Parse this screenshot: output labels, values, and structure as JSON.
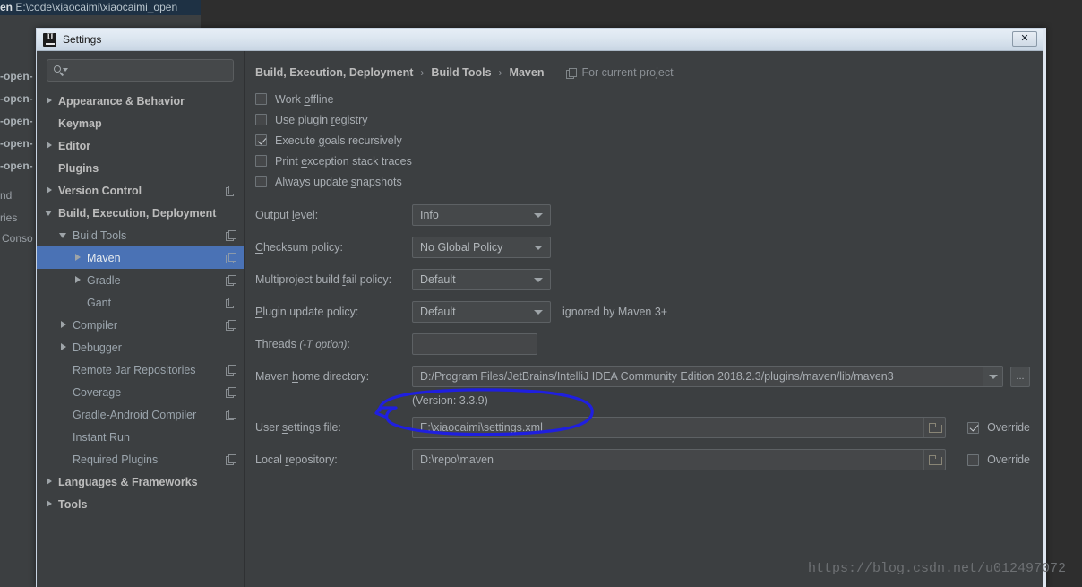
{
  "ide_background": {
    "title_text_bold": "en",
    "title_text": "E:\\code\\xiaocaimi\\xiaocaimi_open",
    "left_items": [
      "-open-",
      "-open-",
      "-open-",
      "-open-",
      "-open-",
      "nd",
      "ries",
      "Conso"
    ]
  },
  "dialog": {
    "title": "Settings",
    "icon": "intellij-idea-icon",
    "close_label": "✕"
  },
  "sidebar": {
    "search": {
      "placeholder": "",
      "value": "",
      "icon": "search-icon"
    },
    "items": [
      {
        "label": "Appearance & Behavior",
        "indent": 0,
        "arrow": "closed",
        "bold": true,
        "copy": false,
        "selected": false
      },
      {
        "label": "Keymap",
        "indent": 0,
        "arrow": "none",
        "bold": true,
        "copy": false,
        "selected": false
      },
      {
        "label": "Editor",
        "indent": 0,
        "arrow": "closed",
        "bold": true,
        "copy": false,
        "selected": false
      },
      {
        "label": "Plugins",
        "indent": 0,
        "arrow": "none",
        "bold": true,
        "copy": false,
        "selected": false
      },
      {
        "label": "Version Control",
        "indent": 0,
        "arrow": "closed",
        "bold": true,
        "copy": true,
        "selected": false
      },
      {
        "label": "Build, Execution, Deployment",
        "indent": 0,
        "arrow": "open",
        "bold": true,
        "copy": false,
        "selected": false
      },
      {
        "label": "Build Tools",
        "indent": 1,
        "arrow": "open",
        "bold": false,
        "copy": true,
        "selected": false
      },
      {
        "label": "Maven",
        "indent": 2,
        "arrow": "closed",
        "bold": false,
        "copy": true,
        "selected": true
      },
      {
        "label": "Gradle",
        "indent": 2,
        "arrow": "closed",
        "bold": false,
        "copy": true,
        "selected": false
      },
      {
        "label": "Gant",
        "indent": 2,
        "arrow": "none",
        "bold": false,
        "copy": true,
        "selected": false
      },
      {
        "label": "Compiler",
        "indent": 1,
        "arrow": "closed",
        "bold": false,
        "copy": true,
        "selected": false
      },
      {
        "label": "Debugger",
        "indent": 1,
        "arrow": "closed",
        "bold": false,
        "copy": false,
        "selected": false
      },
      {
        "label": "Remote Jar Repositories",
        "indent": 1,
        "arrow": "none",
        "bold": false,
        "copy": true,
        "selected": false
      },
      {
        "label": "Coverage",
        "indent": 1,
        "arrow": "none",
        "bold": false,
        "copy": true,
        "selected": false
      },
      {
        "label": "Gradle-Android Compiler",
        "indent": 1,
        "arrow": "none",
        "bold": false,
        "copy": true,
        "selected": false
      },
      {
        "label": "Instant Run",
        "indent": 1,
        "arrow": "none",
        "bold": false,
        "copy": false,
        "selected": false
      },
      {
        "label": "Required Plugins",
        "indent": 1,
        "arrow": "none",
        "bold": false,
        "copy": true,
        "selected": false
      },
      {
        "label": "Languages & Frameworks",
        "indent": 0,
        "arrow": "closed",
        "bold": true,
        "copy": false,
        "selected": false
      },
      {
        "label": "Tools",
        "indent": 0,
        "arrow": "closed",
        "bold": true,
        "copy": false,
        "selected": false
      }
    ]
  },
  "breadcrumb": {
    "crumbs": [
      "Build, Execution, Deployment",
      "Build Tools",
      "Maven"
    ],
    "separator": "›",
    "note": "For current project",
    "note_icon": "copy-icon"
  },
  "checkboxes": [
    {
      "pre": "Work ",
      "mn": "o",
      "post": "ffline",
      "checked": false
    },
    {
      "pre": "Use plugin ",
      "mn": "r",
      "post": "egistry",
      "checked": false
    },
    {
      "pre": "Execute ",
      "mn": "g",
      "post": "oals recursively",
      "checked": true
    },
    {
      "pre": "Print ",
      "mn": "e",
      "post": "xception stack traces",
      "checked": false
    },
    {
      "pre": "Always update ",
      "mn": "s",
      "post": "napshots",
      "checked": false
    }
  ],
  "fields": {
    "output_level": {
      "pre": "Output ",
      "mn": "l",
      "post": "evel:",
      "value": "Info"
    },
    "checksum": {
      "pre": "",
      "mn": "C",
      "post": "hecksum policy:",
      "value": "No Global Policy"
    },
    "multiproject": {
      "pre": "Multiproject build ",
      "mn": "f",
      "post": "ail policy:",
      "value": "Default"
    },
    "plugin_update": {
      "pre": "",
      "mn": "P",
      "post": "lugin update policy:",
      "value": "Default",
      "note": "ignored by Maven 3+"
    },
    "threads": {
      "pre": "Threads ",
      "hint": "(-T option)",
      "post": ":",
      "value": ""
    },
    "maven_home": {
      "pre": "Maven ",
      "mn": "h",
      "post": "ome directory:",
      "value": "D:/Program Files/JetBrains/IntelliJ IDEA Community Edition 2018.2.3/plugins/maven/lib/maven3",
      "browse_label": "...",
      "version_note": "(Version: 3.3.9)"
    },
    "user_settings": {
      "pre": "User ",
      "mn": "s",
      "post": "ettings file:",
      "value": "E:\\xiaocaimi\\settings.xml",
      "override_label": "Override",
      "override_checked": true
    },
    "local_repo": {
      "pre": "Local ",
      "mn": "r",
      "post": "epository:",
      "value": "D:\\repo\\maven",
      "override_label": "Override",
      "override_checked": false
    }
  },
  "annotation": {
    "color": "#1f1fe0",
    "shape": "hand-drawn-ellipse"
  },
  "watermark": "https://blog.csdn.net/u012497072",
  "colors": {
    "dialog_bg": "#3c3f41",
    "selection": "#4a72b5",
    "text": "#a8adb2",
    "titlebar": "#dce6f0"
  }
}
